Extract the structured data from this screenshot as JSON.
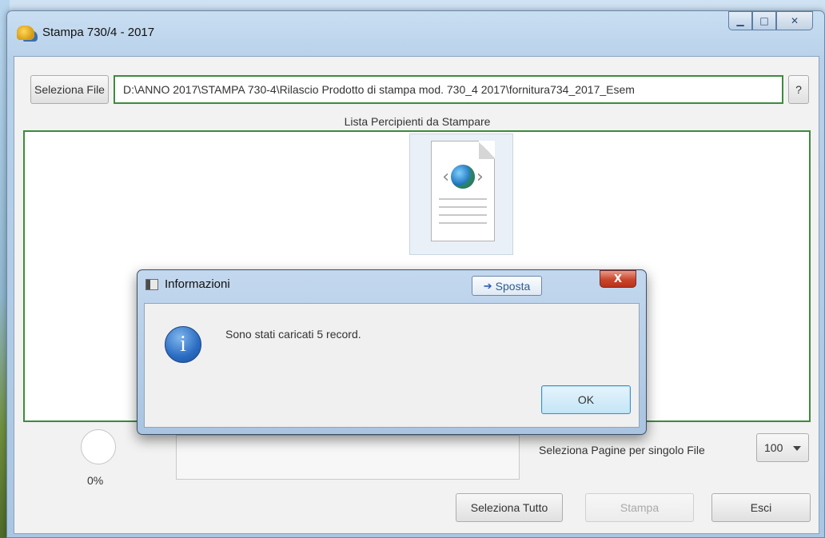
{
  "window": {
    "title": "Stampa 730/4 - 2017"
  },
  "toolbar": {
    "select_file_label": "Seleziona File",
    "file_path": "D:\\ANNO 2017\\STAMPA  730-4\\Rilascio Prodotto di stampa mod. 730_4 2017\\fornitura734_2017_Esem",
    "help_label": "?"
  },
  "list": {
    "label": "Lista Percipienti da Stampare"
  },
  "progress": {
    "percent_label": "0%",
    "value": 0
  },
  "pages": {
    "label": "Seleziona Pagine per singolo File",
    "selected": "100"
  },
  "actions": {
    "select_all_label": "Seleziona Tutto",
    "print_label": "Stampa",
    "exit_label": "Esci"
  },
  "dialog": {
    "title": "Informazioni",
    "move_label": "Sposta",
    "close_label": "X",
    "message": "Sono stati caricati 5 record.",
    "ok_label": "OK",
    "info_glyph": "i"
  },
  "colors": {
    "highlight_border": "#3d8b3d",
    "ok_button_accent": "#3b8fc9"
  },
  "icons": [
    "app-icon",
    "document-web-icon",
    "info-icon",
    "arrow-right-icon",
    "minimize-icon",
    "maximize-icon",
    "close-icon"
  ]
}
